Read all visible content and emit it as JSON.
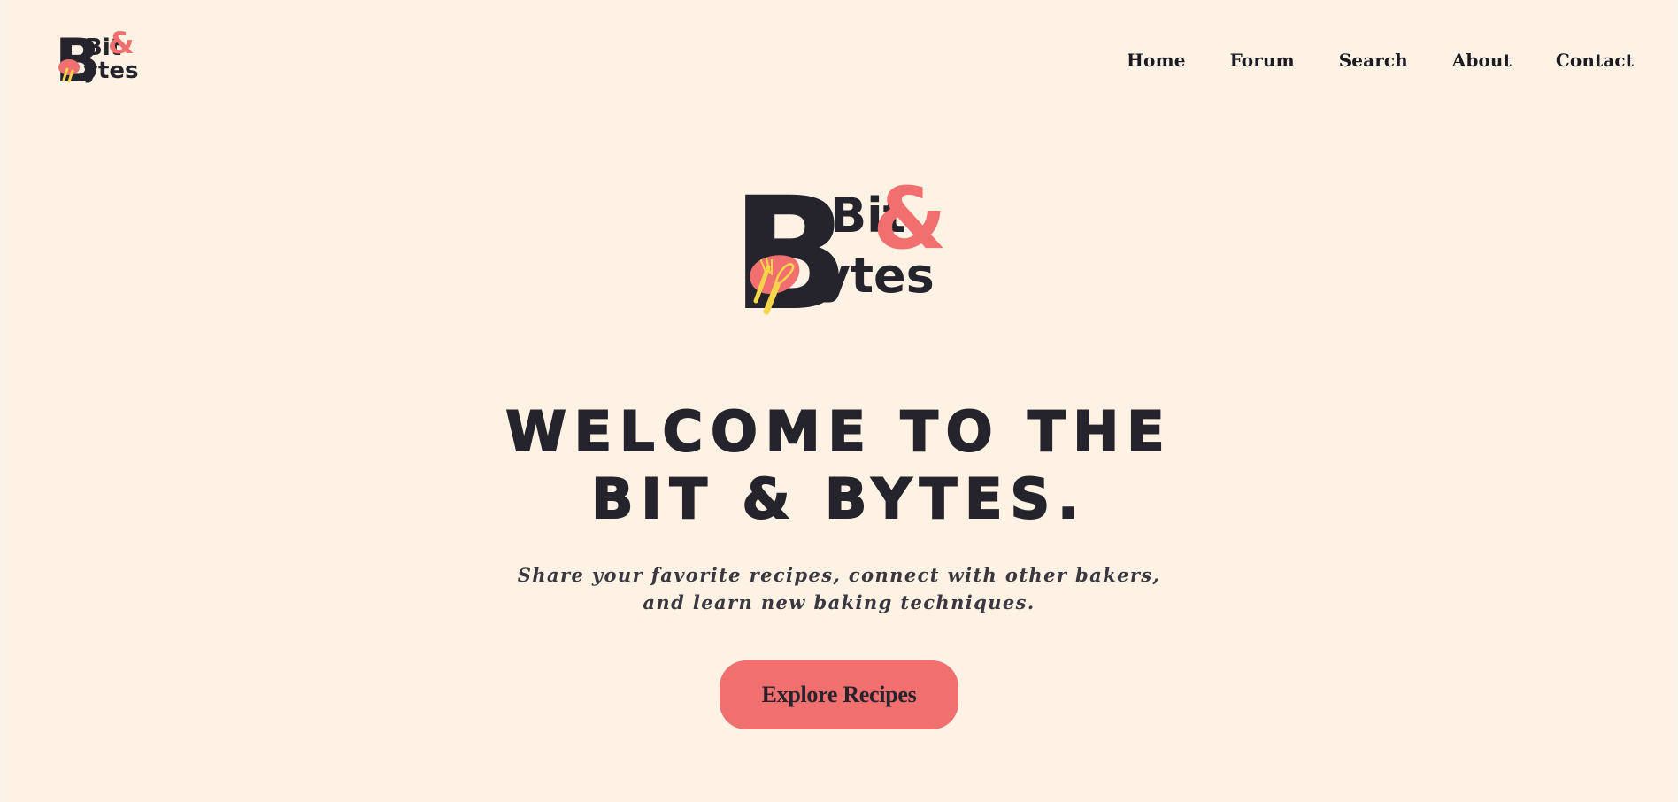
{
  "brand": {
    "logo_line1": "Bit",
    "logo_amp": "&",
    "logo_line2": "ytes",
    "logo_big_letter": "B"
  },
  "nav": {
    "items": [
      {
        "label": "Home"
      },
      {
        "label": "Forum"
      },
      {
        "label": "Search"
      },
      {
        "label": "About"
      },
      {
        "label": "Contact"
      }
    ]
  },
  "hero": {
    "title_line1": "WELCOME TO THE",
    "title_line2": "BIT & BYTES.",
    "subtitle": "Share your favorite recipes, connect with other bakers, and learn new baking techniques.",
    "cta_label": "Explore Recipes"
  },
  "colors": {
    "background": "#fdf2e4",
    "ink": "#25232b",
    "accent": "#f26f70",
    "utensil": "#f5d64a"
  }
}
